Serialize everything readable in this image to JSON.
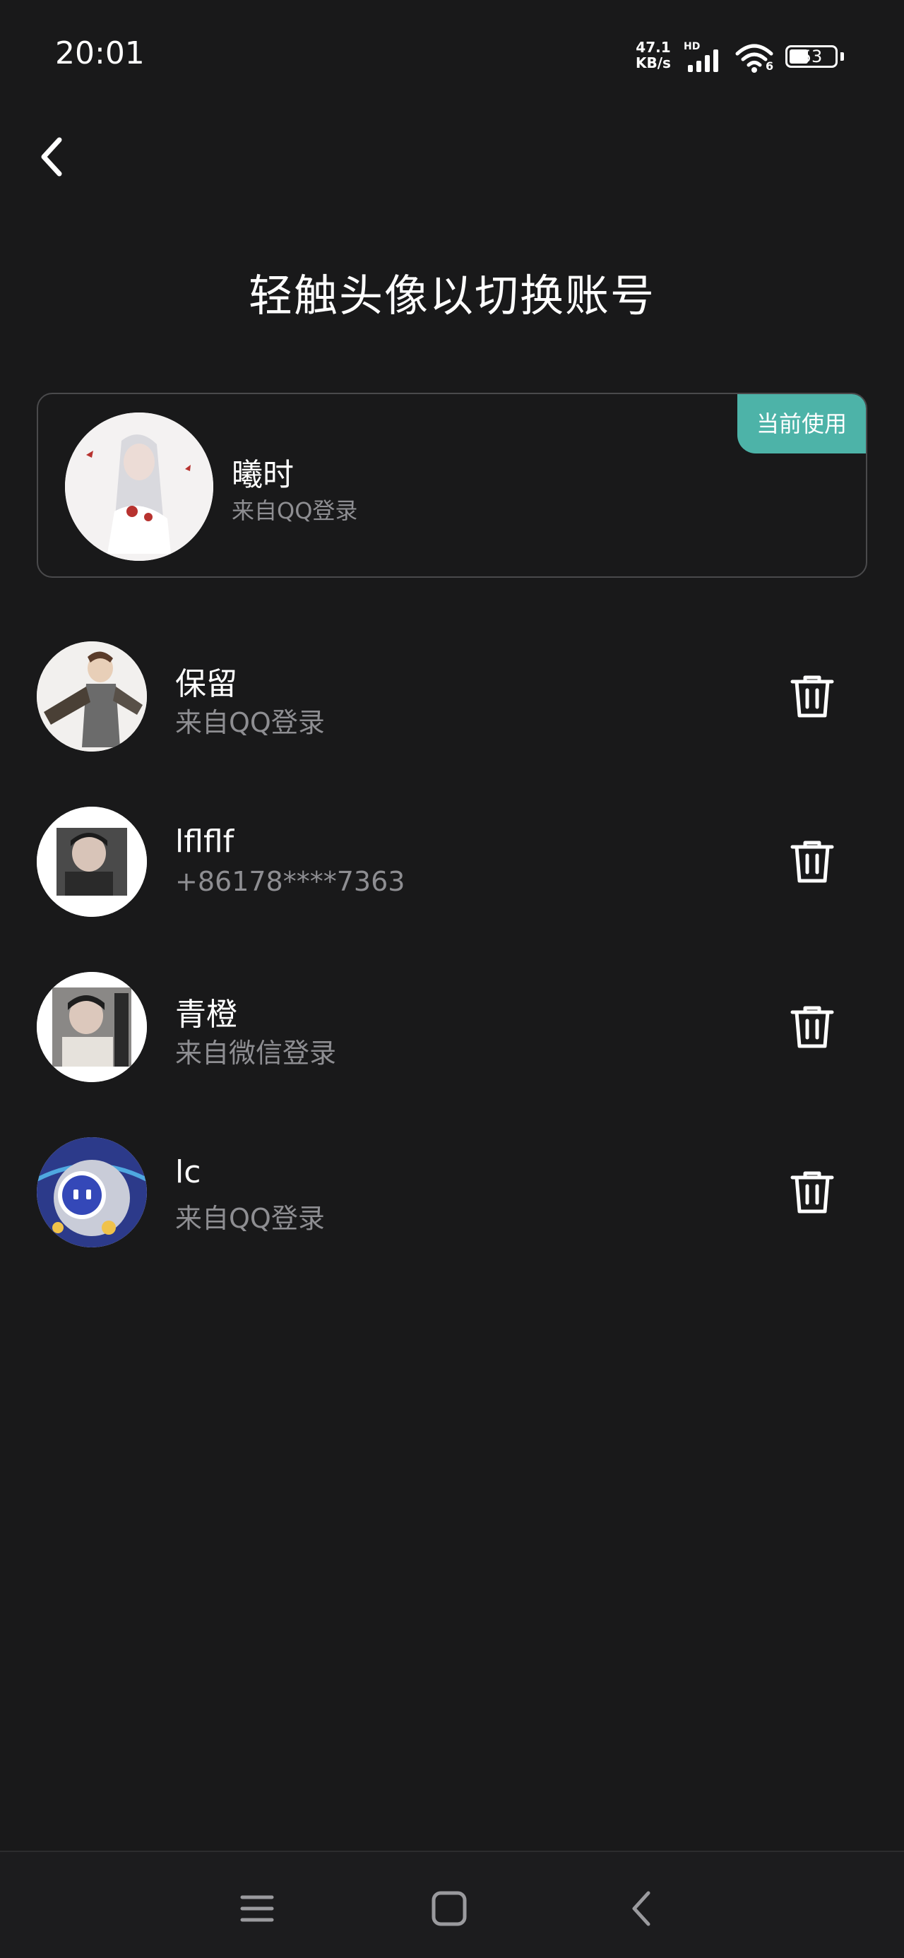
{
  "status_bar": {
    "time": "20:01",
    "net_speed_value": "47.1",
    "net_speed_unit": "KB/s",
    "hd_label": "HD",
    "wifi_label": "6",
    "battery": "53"
  },
  "page": {
    "title": "轻触头像以切换账号"
  },
  "current_account": {
    "badge": "当前使用",
    "name": "曦时",
    "source": "来自QQ登录"
  },
  "accounts": [
    {
      "name": "保留",
      "source": "来自QQ登录"
    },
    {
      "name": "lflflf",
      "source": "+86178****7363"
    },
    {
      "name": "青橙",
      "source": "来自微信登录"
    },
    {
      "name": "lc",
      "source": "来自QQ登录"
    }
  ],
  "icons": {
    "back": "chevron-left-icon",
    "delete": "trash-icon",
    "nav_menu": "menu-icon",
    "nav_home": "home-square-icon",
    "nav_back": "back-arrow-icon"
  },
  "colors": {
    "background": "#19191a",
    "accent": "#4db3a8",
    "secondary_text": "#8e8e92"
  }
}
